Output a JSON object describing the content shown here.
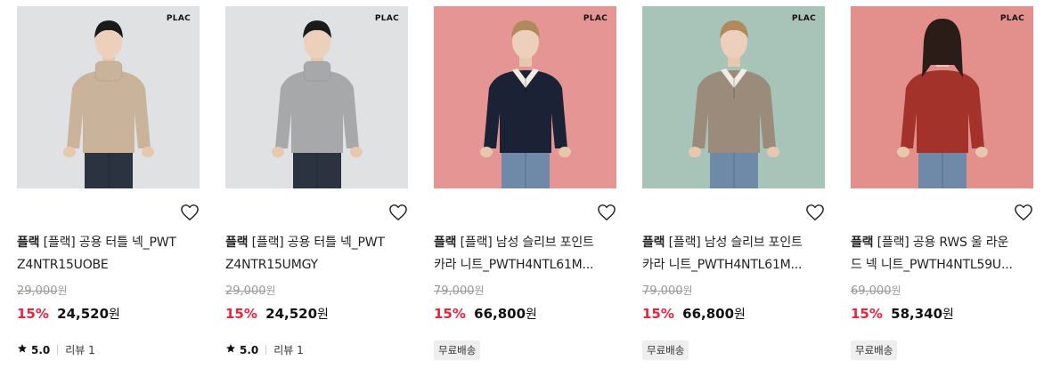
{
  "colors": {
    "sale_rate": "#f0213b",
    "strike": "#999999",
    "badge_bg": "#eeeeee"
  },
  "products": [
    {
      "brand_logo": "PLAC",
      "image_bg": "#dfe1e2",
      "sweater": "#c9b49b",
      "brand": "플랙",
      "title_line1": "[플랙] 공용 터틀 넥_PWT",
      "title_line2": "Z4NTR15UOBE",
      "original_price": "29,000",
      "discount": "15%",
      "sale_price": "24,520",
      "currency": "원",
      "rating": "5.0",
      "reviews": "리뷰 1",
      "badge": null
    },
    {
      "brand_logo": "PLAC",
      "image_bg": "#dfe1e2",
      "sweater": "#a7a8aa",
      "brand": "플랙",
      "title_line1": "[플랙] 공용 터틀 넥_PWT",
      "title_line2": "Z4NTR15UMGY",
      "original_price": "29,000",
      "discount": "15%",
      "sale_price": "24,520",
      "currency": "원",
      "rating": "5.0",
      "reviews": "리뷰 1",
      "badge": null
    },
    {
      "brand_logo": "PLAC",
      "image_bg": "#e59694",
      "sweater": "#1b2236",
      "brand": "플랙",
      "title_line1": "[플랙] 남성 슬리브 포인트",
      "title_line2": "카라 니트_PWTH4NTL61M...",
      "original_price": "79,000",
      "discount": "15%",
      "sale_price": "66,800",
      "currency": "원",
      "rating": null,
      "reviews": null,
      "badge": "무료배송"
    },
    {
      "brand_logo": "PLAC",
      "image_bg": "#a8c3b8",
      "sweater": "#9a8b7a",
      "brand": "플랙",
      "title_line1": "[플랙] 남성 슬리브 포인트",
      "title_line2": "카라 니트_PWTH4NTL61M...",
      "original_price": "79,000",
      "discount": "15%",
      "sale_price": "66,800",
      "currency": "원",
      "rating": null,
      "reviews": null,
      "badge": "무료배송"
    },
    {
      "brand_logo": "PLAC",
      "image_bg": "#e38f8c",
      "sweater": "#a3322a",
      "brand": "플랙",
      "title_line1": "[플랙] 공용 RWS 울 라운",
      "title_line2": "드 넥 니트_PWTH4NTL59U...",
      "original_price": "69,000",
      "discount": "15%",
      "sale_price": "58,340",
      "currency": "원",
      "rating": null,
      "reviews": null,
      "badge": "무료배송"
    }
  ]
}
